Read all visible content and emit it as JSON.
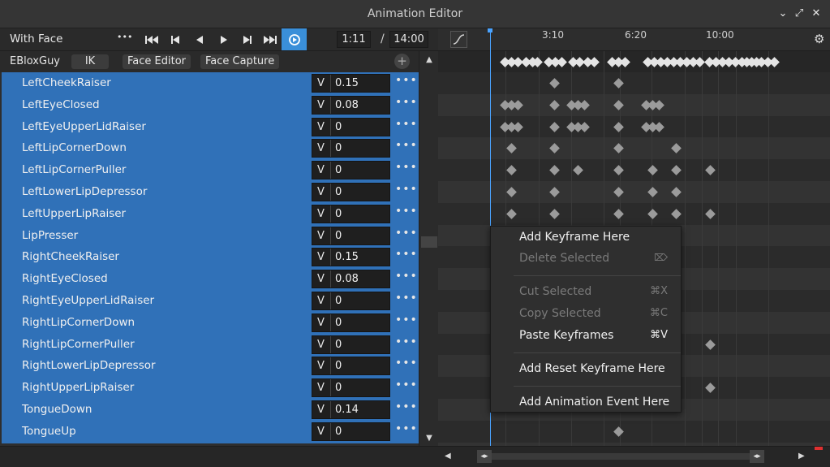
{
  "window": {
    "title": "Animation Editor"
  },
  "toolbar": {
    "animation_name": "With Face",
    "more": "•••",
    "current_time": "1:11",
    "separator": "/",
    "total_time": "14:00"
  },
  "rig": {
    "name": "EBloxGuy",
    "tabs": [
      "IK",
      "Face Editor",
      "Face Capture"
    ],
    "add": "+"
  },
  "properties": [
    {
      "name": "LeftCheekRaiser",
      "value": "0.15"
    },
    {
      "name": "LeftEyeClosed",
      "value": "0.08"
    },
    {
      "name": "LeftEyeUpperLidRaiser",
      "value": "0"
    },
    {
      "name": "LeftLipCornerDown",
      "value": "0"
    },
    {
      "name": "LeftLipCornerPuller",
      "value": "0"
    },
    {
      "name": "LeftLowerLipDepressor",
      "value": "0"
    },
    {
      "name": "LeftUpperLipRaiser",
      "value": "0"
    },
    {
      "name": "LipPresser",
      "value": "0"
    },
    {
      "name": "RightCheekRaiser",
      "value": "0.15"
    },
    {
      "name": "RightEyeClosed",
      "value": "0.08"
    },
    {
      "name": "RightEyeUpperLidRaiser",
      "value": "0"
    },
    {
      "name": "RightLipCornerDown",
      "value": "0"
    },
    {
      "name": "RightLipCornerPuller",
      "value": "0"
    },
    {
      "name": "RightLowerLipDepressor",
      "value": "0"
    },
    {
      "name": "RightUpperLipRaiser",
      "value": "0"
    },
    {
      "name": "TongueDown",
      "value": "0.14"
    },
    {
      "name": "TongueUp",
      "value": "0"
    }
  ],
  "value_prefix": "V",
  "row_more": "•••",
  "timeline": {
    "ticks": [
      "3:10",
      "6:20",
      "10:00"
    ]
  },
  "context_menu": {
    "add_keyframe": "Add Keyframe Here",
    "delete_selected": "Delete Selected",
    "cut_selected": "Cut Selected",
    "cut_shortcut": "⌘X",
    "copy_selected": "Copy Selected",
    "copy_shortcut": "⌘C",
    "paste_keyframes": "Paste Keyframes",
    "paste_shortcut": "⌘V",
    "add_reset_keyframe": "Add Reset Keyframe Here",
    "add_animation_event": "Add Animation Event Here"
  },
  "colors": {
    "accent": "#3a8fd9",
    "selected_rows": "#3071b8",
    "scrubber": "#4aa3ff"
  }
}
